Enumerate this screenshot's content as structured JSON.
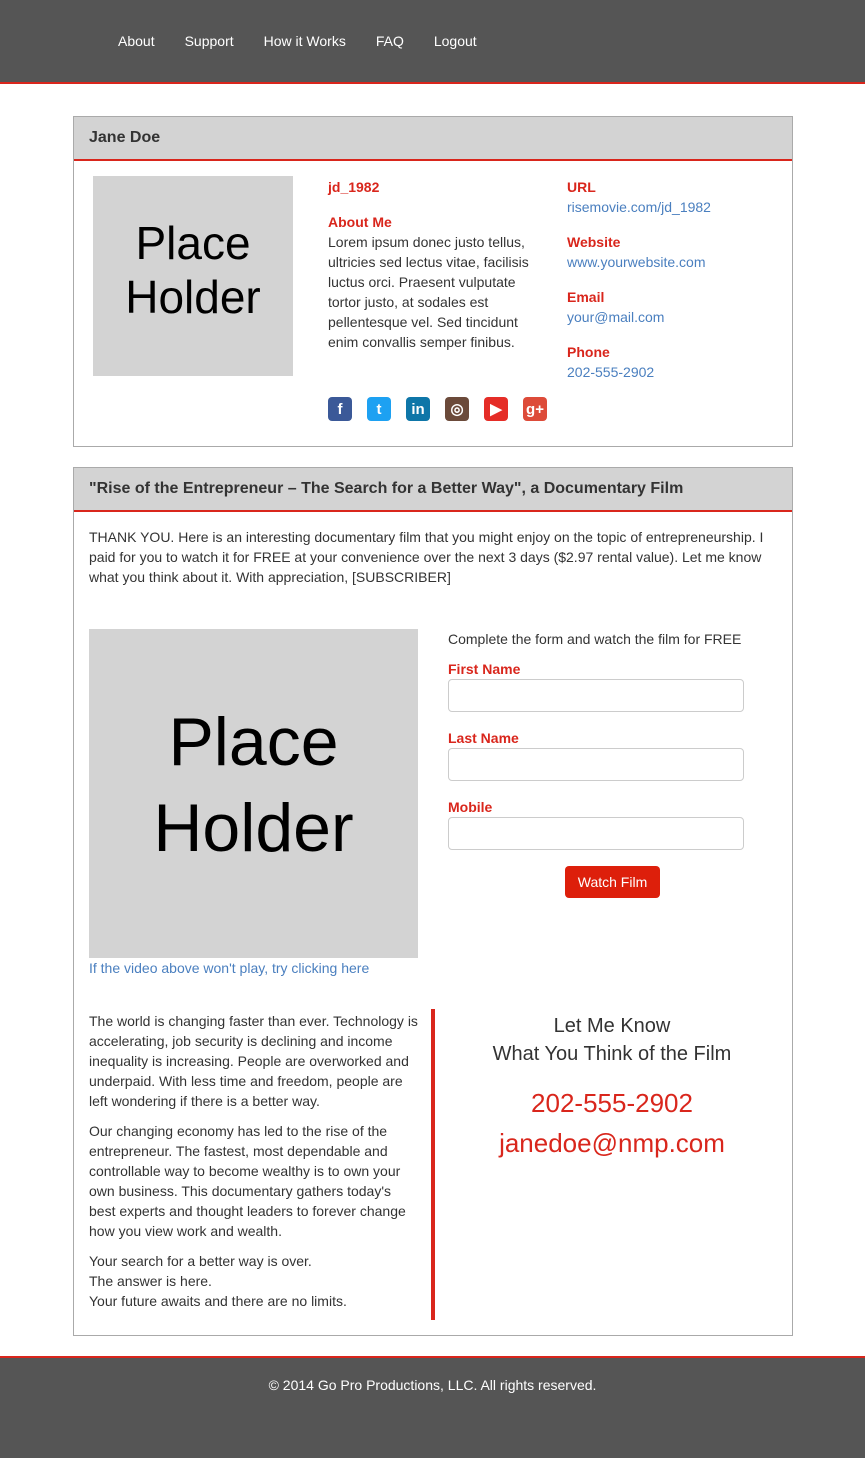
{
  "nav": {
    "items": [
      {
        "label": "About"
      },
      {
        "label": "Support"
      },
      {
        "label": "How it Works"
      },
      {
        "label": "FAQ"
      },
      {
        "label": "Logout"
      }
    ]
  },
  "profile": {
    "name": "Jane Doe",
    "placeholder_line1": "Place",
    "placeholder_line2": "Holder",
    "username": "jd_1982",
    "about_label": "About Me",
    "about_text": "Lorem ipsum donec justo tellus, ultricies sed lectus vitae, facilisis luctus orci. Praesent vulputate tortor justo, at sodales est pellentesque vel. Sed tincidunt enim convallis semper finibus.",
    "url_label": "URL",
    "url_value": "risemovie.com/jd_1982",
    "website_label": "Website",
    "website_value": "www.yourwebsite.com",
    "email_label": "Email",
    "email_value": "your@mail.com",
    "phone_label": "Phone",
    "phone_value": "202-555-2902",
    "social": [
      {
        "name": "facebook-icon",
        "glyph": "f",
        "color": "#3b5998"
      },
      {
        "name": "twitter-icon",
        "glyph": "t",
        "color": "#1da1f2"
      },
      {
        "name": "linkedin-icon",
        "glyph": "in",
        "color": "#0e76a8"
      },
      {
        "name": "instagram-icon",
        "glyph": "◎",
        "color": "#6b4a3a"
      },
      {
        "name": "youtube-icon",
        "glyph": "▶",
        "color": "#e52d27"
      },
      {
        "name": "google-plus-icon",
        "glyph": "g+",
        "color": "#dd4b39"
      }
    ]
  },
  "film": {
    "title": "\"Rise of the Entrepreneur – The Search for a Better Way\", a Documentary Film",
    "intro": "THANK YOU. Here is an interesting documentary film that you might enjoy on the topic of entrepreneurship. I paid for you to watch it for FREE at your convenience over the next 3 days ($2.97 rental value). Let me know what you think about it. With appreciation, [SUBSCRIBER]",
    "placeholder_line1": "Place",
    "placeholder_line2": "Holder",
    "video_link": "If the video above won't play, try clicking here",
    "form_intro": "Complete the form and watch the film for FREE",
    "first_name_label": "First Name",
    "last_name_label": "Last Name",
    "mobile_label": "Mobile",
    "watch_button": "Watch Film",
    "para1": "The world is changing faster than ever. Technology is accelerating, job security is declining and income inequality is increasing. People are overworked and underpaid. With less time and freedom, people are left wondering if there is a better way.",
    "para2": "Our changing economy has led to the rise of the entrepreneur. The fastest, most dependable and controllable way to become wealthy is to own your own business. This documentary gathers today's best experts and thought leaders to forever change how you view work and wealth.",
    "para3_line1": "Your search for a better way is over.",
    "para3_line2": "The answer is here.",
    "para3_line3": "Your future awaits and there are no limits.",
    "contact_heading_line1": "Let Me Know",
    "contact_heading_line2": "What You Think of the Film",
    "contact_phone": "202-555-2902",
    "contact_email": "janedoe@nmp.com"
  },
  "footer": {
    "copyright": "© 2014 Go Pro Productions, LLC. All rights reserved."
  },
  "colors": {
    "accent": "#d9261c",
    "nav_bg": "#555555",
    "link": "#4a7fbf",
    "panel_head": "#d3d3d3"
  }
}
